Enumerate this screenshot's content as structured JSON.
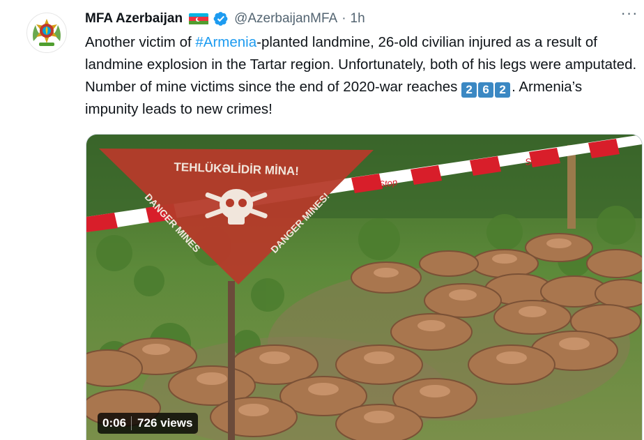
{
  "account": {
    "display_name": "MFA Azerbaijan",
    "flag": "azerbaijan-flag",
    "handle": "@AzerbaijanMFA",
    "separator": "·",
    "timestamp": "1h",
    "more": "···"
  },
  "tweet": {
    "text_1": "Another victim of ",
    "hashtag": "#Armenia",
    "text_2": "-planted landmine, 26-old civilian injured as a result of landmine explosion in the Tartar region. Unfortunately, both of his legs were amputated. Number of mine victims since the end of 2020-war reaches ",
    "digits": [
      "2",
      "6",
      "2"
    ],
    "text_3": ". Armenia’s impunity leads to new crimes!"
  },
  "media": {
    "sign_text": "TEHLÜKƏLİDİR MİNA!",
    "sign_left": "DANGER MINES",
    "sign_right": "DANGER MINES!",
    "tape_text": "Stop",
    "duration": "0:06",
    "views": "726 views"
  },
  "colors": {
    "link": "#1d9bf0",
    "secondary": "#536471",
    "verified": "#1d9bf0",
    "keycap": "#3b88c3"
  }
}
